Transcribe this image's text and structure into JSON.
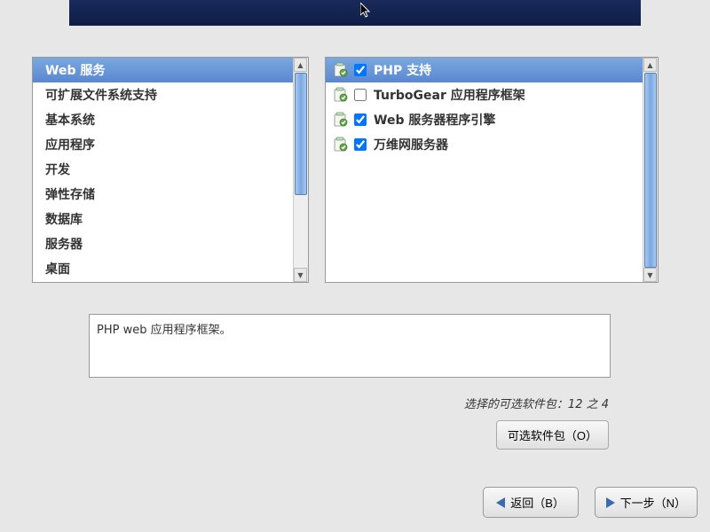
{
  "categories": {
    "selected_index": 0,
    "items": [
      "Web 服务",
      "可扩展文件系统支持",
      "基本系统",
      "应用程序",
      "开发",
      "弹性存储",
      "数据库",
      "服务器",
      "桌面"
    ]
  },
  "packages": {
    "selected_index": 0,
    "items": [
      {
        "label": "PHP 支持",
        "checked": true
      },
      {
        "label": "TurboGear 应用程序框架",
        "checked": false
      },
      {
        "label": "Web 服务器程序引擎",
        "checked": true
      },
      {
        "label": "万维网服务器",
        "checked": true
      }
    ]
  },
  "description": "PHP web 应用程序框架。",
  "status_prefix": "选择",
  "status_mid": "的可选软件包：",
  "status_count": "12 之 4",
  "buttons": {
    "optional": "可选软件包（O）",
    "back": "返回（B）",
    "next": "下一步（N）"
  }
}
